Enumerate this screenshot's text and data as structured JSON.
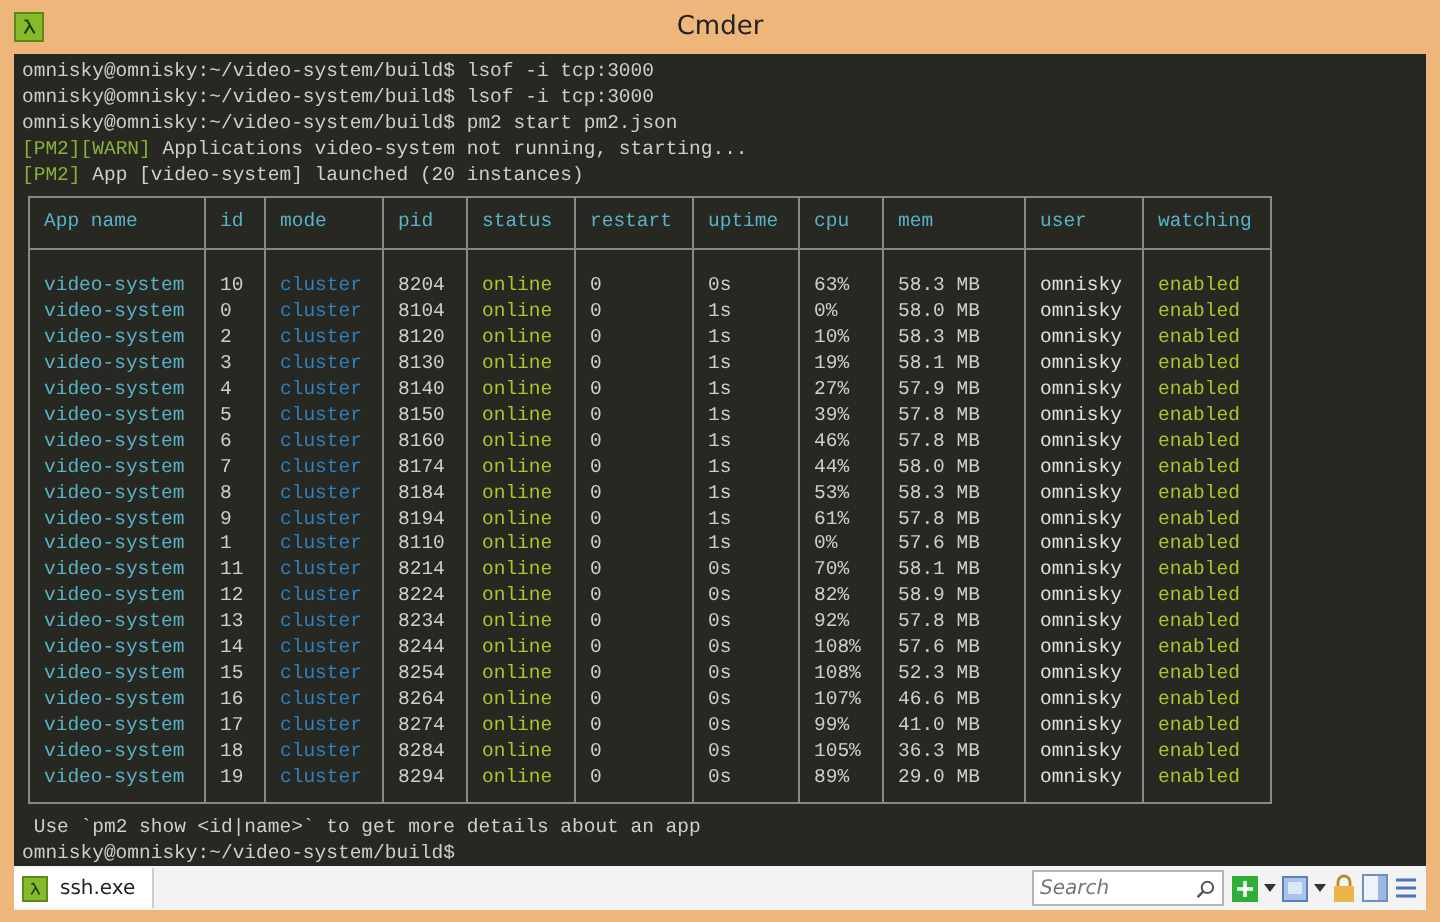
{
  "window": {
    "title": "Cmder"
  },
  "lines": [
    {
      "kind": "prompt",
      "prompt": "omnisky@omnisky:~/video-system/build$",
      "command": "lsof -i tcp:3000"
    },
    {
      "kind": "prompt",
      "prompt": "omnisky@omnisky:~/video-system/build$",
      "command": "lsof -i tcp:3000"
    },
    {
      "kind": "prompt",
      "prompt": "omnisky@omnisky:~/video-system/build$",
      "command": "pm2 start pm2.json"
    },
    {
      "kind": "log",
      "tags": [
        "[PM2]",
        "[WARN]"
      ],
      "text": "Applications video-system not running, starting..."
    },
    {
      "kind": "log",
      "tags": [
        "[PM2]"
      ],
      "text": "App [video-system] launched (20 instances)"
    }
  ],
  "table": {
    "columns": [
      "App name",
      "id",
      "mode",
      "pid",
      "status",
      "restart",
      "uptime",
      "cpu",
      "mem",
      "user",
      "watching"
    ],
    "rows": [
      [
        "video-system",
        "10",
        "cluster",
        "8204",
        "online",
        "0",
        "0s",
        "63%",
        "58.3 MB",
        "omnisky",
        "enabled"
      ],
      [
        "video-system",
        "0",
        "cluster",
        "8104",
        "online",
        "0",
        "1s",
        "0%",
        "58.0 MB",
        "omnisky",
        "enabled"
      ],
      [
        "video-system",
        "2",
        "cluster",
        "8120",
        "online",
        "0",
        "1s",
        "10%",
        "58.3 MB",
        "omnisky",
        "enabled"
      ],
      [
        "video-system",
        "3",
        "cluster",
        "8130",
        "online",
        "0",
        "1s",
        "19%",
        "58.1 MB",
        "omnisky",
        "enabled"
      ],
      [
        "video-system",
        "4",
        "cluster",
        "8140",
        "online",
        "0",
        "1s",
        "27%",
        "57.9 MB",
        "omnisky",
        "enabled"
      ],
      [
        "video-system",
        "5",
        "cluster",
        "8150",
        "online",
        "0",
        "1s",
        "39%",
        "57.8 MB",
        "omnisky",
        "enabled"
      ],
      [
        "video-system",
        "6",
        "cluster",
        "8160",
        "online",
        "0",
        "1s",
        "46%",
        "57.8 MB",
        "omnisky",
        "enabled"
      ],
      [
        "video-system",
        "7",
        "cluster",
        "8174",
        "online",
        "0",
        "1s",
        "44%",
        "58.0 MB",
        "omnisky",
        "enabled"
      ],
      [
        "video-system",
        "8",
        "cluster",
        "8184",
        "online",
        "0",
        "1s",
        "53%",
        "58.3 MB",
        "omnisky",
        "enabled"
      ],
      [
        "video-system",
        "9",
        "cluster",
        "8194",
        "online",
        "0",
        "1s",
        "61%",
        "57.8 MB",
        "omnisky",
        "enabled"
      ],
      [
        "video-system",
        "1",
        "cluster",
        "8110",
        "online",
        "0",
        "1s",
        "0%",
        "57.6 MB",
        "omnisky",
        "enabled"
      ],
      [
        "video-system",
        "11",
        "cluster",
        "8214",
        "online",
        "0",
        "0s",
        "70%",
        "58.1 MB",
        "omnisky",
        "enabled"
      ],
      [
        "video-system",
        "12",
        "cluster",
        "8224",
        "online",
        "0",
        "0s",
        "82%",
        "58.9 MB",
        "omnisky",
        "enabled"
      ],
      [
        "video-system",
        "13",
        "cluster",
        "8234",
        "online",
        "0",
        "0s",
        "92%",
        "57.8 MB",
        "omnisky",
        "enabled"
      ],
      [
        "video-system",
        "14",
        "cluster",
        "8244",
        "online",
        "0",
        "0s",
        "108%",
        "57.6 MB",
        "omnisky",
        "enabled"
      ],
      [
        "video-system",
        "15",
        "cluster",
        "8254",
        "online",
        "0",
        "0s",
        "108%",
        "52.3 MB",
        "omnisky",
        "enabled"
      ],
      [
        "video-system",
        "16",
        "cluster",
        "8264",
        "online",
        "0",
        "0s",
        "107%",
        "46.6 MB",
        "omnisky",
        "enabled"
      ],
      [
        "video-system",
        "17",
        "cluster",
        "8274",
        "online",
        "0",
        "0s",
        "99%",
        "41.0 MB",
        "omnisky",
        "enabled"
      ],
      [
        "video-system",
        "18",
        "cluster",
        "8284",
        "online",
        "0",
        "0s",
        "105%",
        "36.3 MB",
        "omnisky",
        "enabled"
      ],
      [
        "video-system",
        "19",
        "cluster",
        "8294",
        "online",
        "0",
        "0s",
        "89%",
        "29.0 MB",
        "omnisky",
        "enabled"
      ]
    ]
  },
  "hint": "Use `pm2 show <id|name>` to get more details about an app",
  "final_prompt": "omnisky@omnisky:~/video-system/build$",
  "status_bar": {
    "tab": "ssh.exe",
    "search": {
      "placeholder": "Search"
    }
  }
}
